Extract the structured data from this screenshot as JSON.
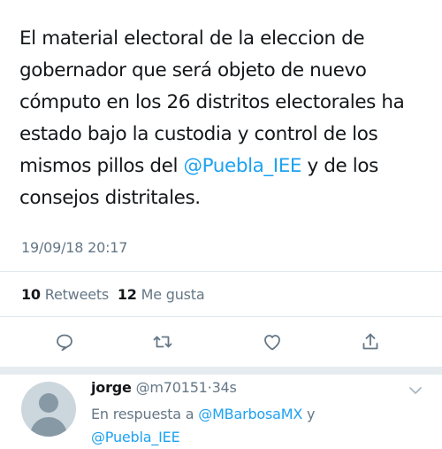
{
  "tweet": {
    "text_part1": "El material electoral de la eleccion de gobernador que será objeto de nuevo cómputo en los 26 distritos electorales ha estado bajo la custodia y control de los mismos pillos del ",
    "mention": "@Puebla_IEE",
    "text_part2": " y de los consejos distritales.",
    "timestamp": "19/09/18 20:17",
    "retweet_count": "10",
    "retweet_label": "Retweets",
    "like_count": "12",
    "like_label": "Me gusta"
  },
  "actions": [
    {
      "icon": "reply-icon"
    },
    {
      "icon": "retweet-icon"
    },
    {
      "icon": "heart-icon"
    },
    {
      "icon": "share-icon"
    }
  ],
  "reply": {
    "name": "jorge",
    "handle": "@m70151",
    "separator": "·",
    "time": "34s",
    "context_prefix": "En respuesta a",
    "mention_1": "@MBarbosaMX",
    "conjunction": "y",
    "mention_2": "@Puebla_IEE"
  },
  "colors": {
    "accent": "#1da1f2",
    "text": "#14171a",
    "secondary": "#657786",
    "divider": "#e1e8ed"
  }
}
